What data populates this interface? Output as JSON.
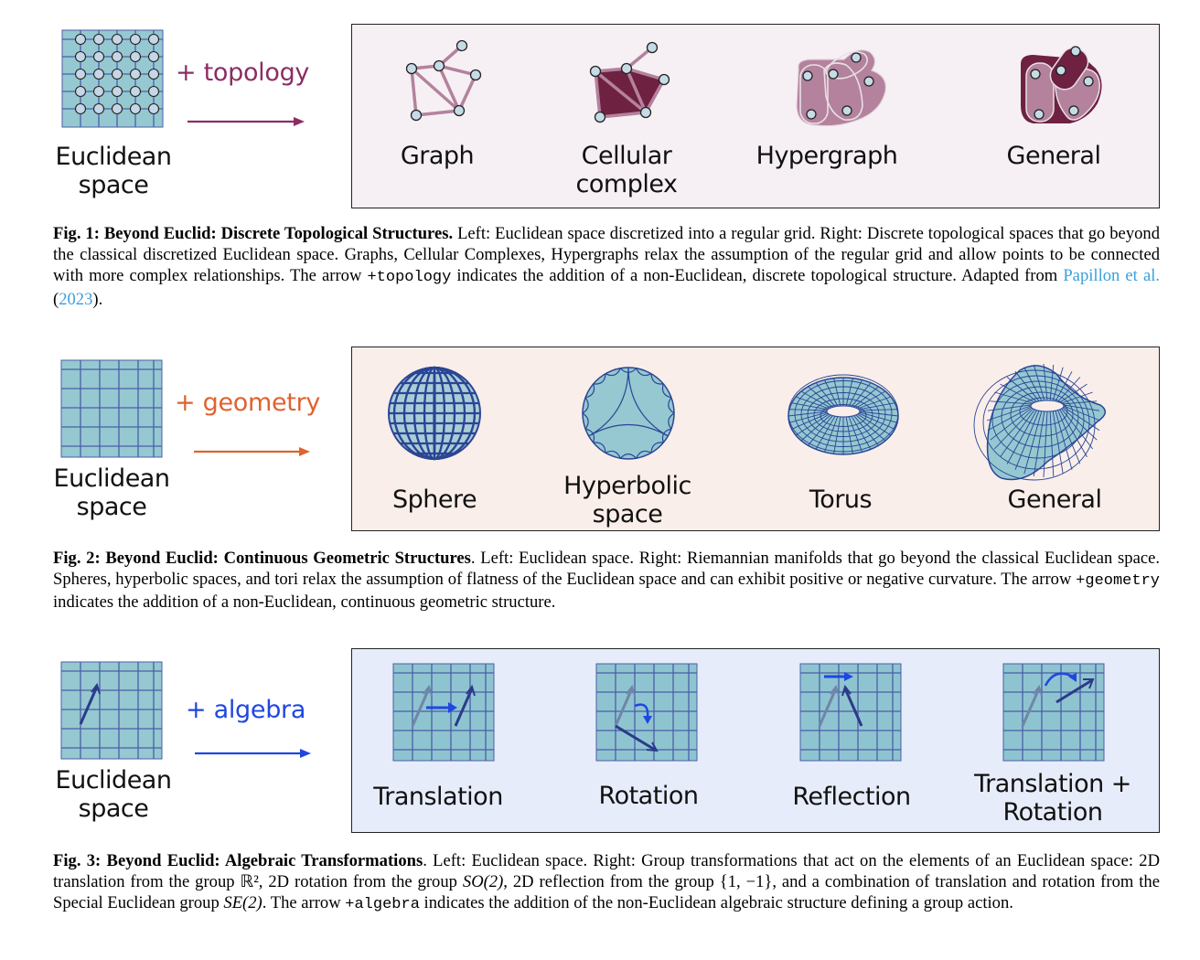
{
  "colors": {
    "topology": "#8b2d63",
    "geometry": "#e0622e",
    "algebra": "#1f47e0",
    "grid_fill": "#95c8d0",
    "grid_line": "#4a5ea8",
    "panel1_bg": "#f6f0f4",
    "panel2_bg": "#faeeea",
    "panel3_bg": "#e7ecfa",
    "link": "#3aa0dc"
  },
  "fig1": {
    "left_label_line1": "Euclidean",
    "left_label_line2": "space",
    "operator": "+ topology",
    "items": [
      {
        "line1": "Graph",
        "line2": ""
      },
      {
        "line1": "Cellular",
        "line2": "complex"
      },
      {
        "line1": "Hypergraph",
        "line2": ""
      },
      {
        "line1": "General",
        "line2": ""
      }
    ],
    "caption": {
      "label": "Fig. 1:",
      "title": "Beyond Euclid: Discrete Topological Structures.",
      "text1": " Left: Euclidean space discretized into a regular grid. Right: Discrete topological spaces that go beyond the classical discretized Euclidean space. Graphs, Cellular Complexes, Hypergraphs relax the assumption of the regular grid and allow points to be connected with more complex relationships. The arrow ",
      "code": "+topology",
      "text2": " indicates the addition of a non-Euclidean, discrete topological structure. Adapted from ",
      "cite_authors": "Papillon et al.",
      "cite_open": " (",
      "cite_year": "2023",
      "cite_close": ")."
    }
  },
  "fig2": {
    "left_label_line1": "Euclidean",
    "left_label_line2": "space",
    "operator": "+ geometry",
    "items": [
      {
        "line1": "Sphere",
        "line2": ""
      },
      {
        "line1": "Hyperbolic",
        "line2": "space"
      },
      {
        "line1": "Torus",
        "line2": ""
      },
      {
        "line1": "General",
        "line2": ""
      }
    ],
    "caption": {
      "label": "Fig. 2:",
      "title": "Beyond Euclid: Continuous Geometric Structures",
      "text1": ". Left: Euclidean space. Right: Riemannian manifolds that go beyond the classical Euclidean space. Spheres, hyperbolic spaces, and tori relax the assumption of flatness of the Euclidean space and can exhibit positive or negative curvature. The arrow ",
      "code": "+geometry",
      "text2": " indicates the addition of a non-Euclidean, continuous geometric structure."
    }
  },
  "fig3": {
    "left_label_line1": "Euclidean",
    "left_label_line2": "space",
    "operator": "+ algebra",
    "items": [
      {
        "line1": "Translation",
        "line2": ""
      },
      {
        "line1": "Rotation",
        "line2": ""
      },
      {
        "line1": "Reflection",
        "line2": ""
      },
      {
        "line1": "Translation +",
        "line2": "Rotation"
      }
    ],
    "caption": {
      "label": "Fig. 3:",
      "title": "Beyond Euclid: Algebraic Transformations",
      "text1": ". Left: Euclidean space. Right: Group transformations that act on the elements of an Euclidean space: 2D translation from the group ",
      "math1": "ℝ²",
      "text2": ", 2D rotation from the group ",
      "math2": "SO(2)",
      "text3": ", 2D reflection from the group ",
      "math3": "{1, −1}",
      "text4": ", and a combination of translation and rotation from the Special Euclidean group ",
      "math4": "SE(2)",
      "text5": ". The arrow ",
      "code": "+algebra",
      "text6": " indicates the addition of the non-Euclidean algebraic structure defining a group action."
    }
  }
}
